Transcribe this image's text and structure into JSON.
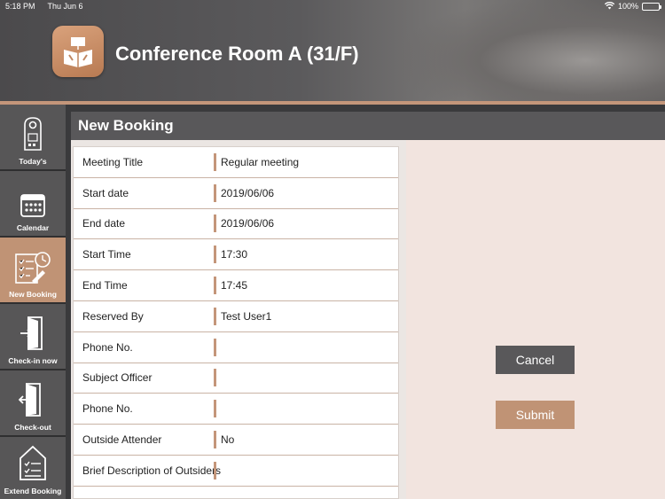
{
  "status_bar": {
    "time": "5:18 PM",
    "date": "Thu Jun 6",
    "battery": "100%"
  },
  "header": {
    "title": "Conference Room A (31/F)"
  },
  "sidebar": {
    "items": [
      {
        "label": "Today's",
        "icon": "door-hanger-icon"
      },
      {
        "label": "Calendar",
        "icon": "calendar-icon"
      },
      {
        "label": "New Booking",
        "icon": "clipboard-clock-icon",
        "active": true
      },
      {
        "label": "Check-in now",
        "icon": "door-enter-icon"
      },
      {
        "label": "Check-out",
        "icon": "door-exit-icon"
      },
      {
        "label": "Extend Booking",
        "icon": "house-checklist-icon"
      }
    ]
  },
  "panel": {
    "title": "New Booking"
  },
  "form": {
    "rows": [
      {
        "label": "Meeting Title",
        "value": "Regular meeting"
      },
      {
        "label": "Start date",
        "value": "2019/06/06"
      },
      {
        "label": "End date",
        "value": "2019/06/06"
      },
      {
        "label": "Start Time",
        "value": "17:30"
      },
      {
        "label": "End Time",
        "value": "17:45"
      },
      {
        "label": "Reserved By",
        "value": "Test User1"
      },
      {
        "label": "Phone No.",
        "value": ""
      },
      {
        "label": "Subject Officer",
        "value": ""
      },
      {
        "label": "Phone No.",
        "value": ""
      },
      {
        "label": "Outside Attender",
        "value": "No"
      },
      {
        "label": "Brief Description of Outsiders",
        "value": ""
      }
    ]
  },
  "actions": {
    "cancel_label": "Cancel",
    "submit_label": "Submit"
  },
  "colors": {
    "accent": "#c09375",
    "dark": "#59585a",
    "panel_bg": "#f2e4df"
  }
}
